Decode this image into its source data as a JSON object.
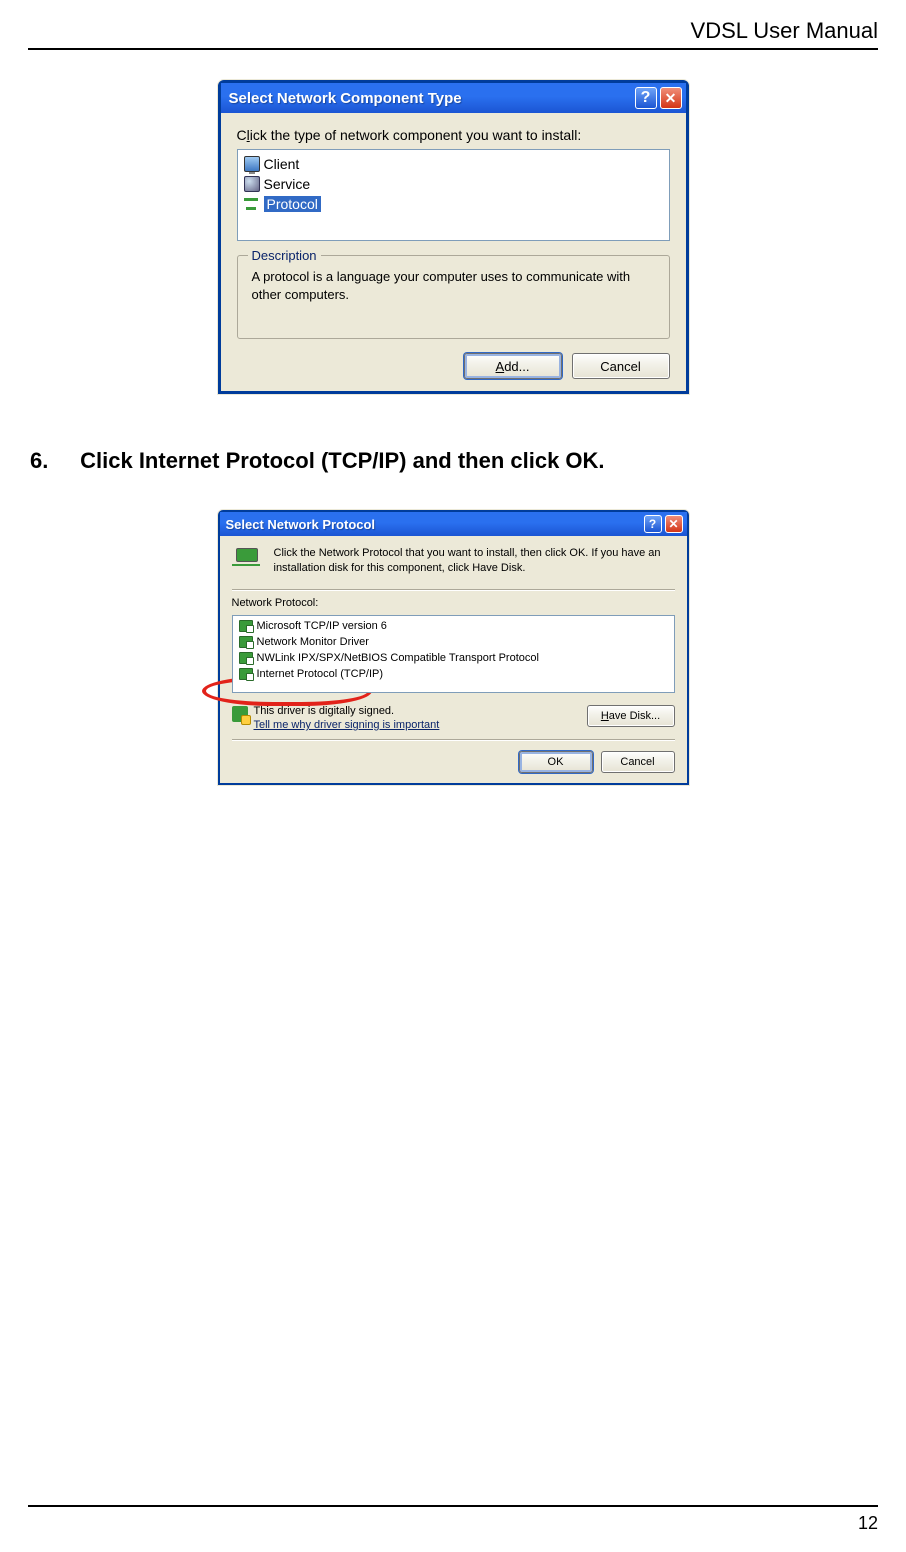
{
  "header": {
    "title": "VDSL User Manual"
  },
  "footer": {
    "page_number": "12"
  },
  "step": {
    "number": "6.",
    "text": "Click Internet Protocol (TCP/IP) and then click OK."
  },
  "dialog1": {
    "title": "Select Network Component Type",
    "prompt_pre": "C",
    "prompt_underline": "l",
    "prompt_post": "ick the type of network component you want to install:",
    "items": {
      "client": "Client",
      "service": "Service",
      "protocol": "Protocol"
    },
    "group_legend": "Description",
    "group_text": "A protocol is a language your computer uses to communicate with other computers.",
    "btn_add_pre": "",
    "btn_add_u": "A",
    "btn_add_post": "dd...",
    "btn_cancel": "Cancel"
  },
  "dialog2": {
    "title": "Select Network Protocol",
    "instructions": "Click the Network Protocol that you want to install, then click OK. If you have an installation disk for this component, click Have Disk.",
    "list_label": "Network Protocol:",
    "items": {
      "p1": "Microsoft TCP/IP version 6",
      "p2": "Network Monitor Driver",
      "p3": "NWLink IPX/SPX/NetBIOS Compatible Transport Protocol",
      "p4": "Internet Protocol (TCP/IP)"
    },
    "signed_line": "This driver is digitally signed.",
    "signed_link": "Tell me why driver signing is important",
    "btn_havedisk_u": "H",
    "btn_havedisk_post": "ave Disk...",
    "btn_ok": "OK",
    "btn_cancel": "Cancel"
  }
}
